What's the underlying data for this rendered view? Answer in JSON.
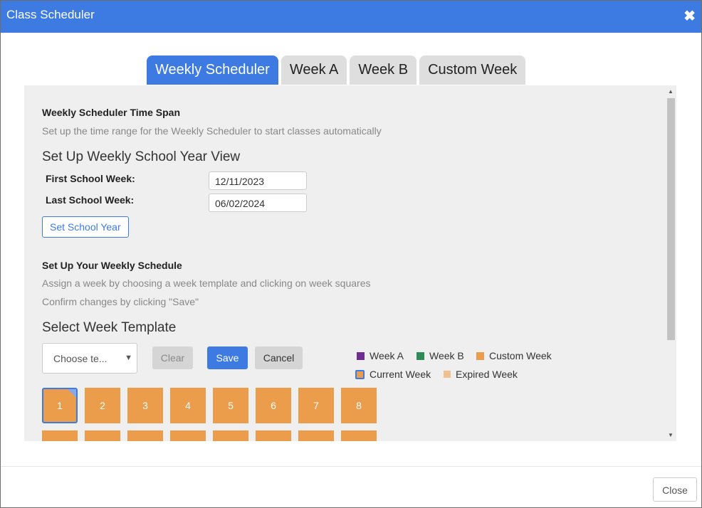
{
  "dialog": {
    "title": "Class Scheduler",
    "close_icon": "close-icon",
    "footer_close": "Close"
  },
  "tabs": [
    {
      "label": "Weekly Scheduler",
      "active": true
    },
    {
      "label": "Week A"
    },
    {
      "label": "Week B"
    },
    {
      "label": "Custom Week"
    }
  ],
  "time_span": {
    "heading": "Weekly Scheduler Time Span",
    "description": "Set up the time range for the Weekly Scheduler to start classes automatically"
  },
  "year_view": {
    "heading": "Set Up Weekly School Year View",
    "first_label": "First School Week:",
    "first_value": "12/11/2023",
    "last_label": "Last School Week:",
    "last_value": "06/02/2024",
    "button": "Set School Year"
  },
  "schedule": {
    "heading": "Set Up Your Weekly Schedule",
    "line1": "Assign a week by choosing a week template and clicking on week squares",
    "line2": "Confirm changes by clicking \"Save\""
  },
  "template": {
    "heading": "Select Week Template",
    "select_value": "Choose te...",
    "clear": "Clear",
    "save": "Save",
    "cancel": "Cancel"
  },
  "legend": {
    "week_a": "Week A",
    "week_b": "Week B",
    "custom": "Custom Week",
    "current": "Current Week",
    "expired": "Expired Week",
    "colors": {
      "week_a": "#6f2c91",
      "week_b": "#2e8b57",
      "custom": "#ec9d4b",
      "current_border": "#3d7be3",
      "expired": "#f0c090"
    }
  },
  "weeks": [
    "1",
    "2",
    "3",
    "4",
    "5",
    "6",
    "7",
    "8"
  ],
  "colors": {
    "accent": "#3d7be3",
    "week_fill": "#ec9d4b"
  }
}
